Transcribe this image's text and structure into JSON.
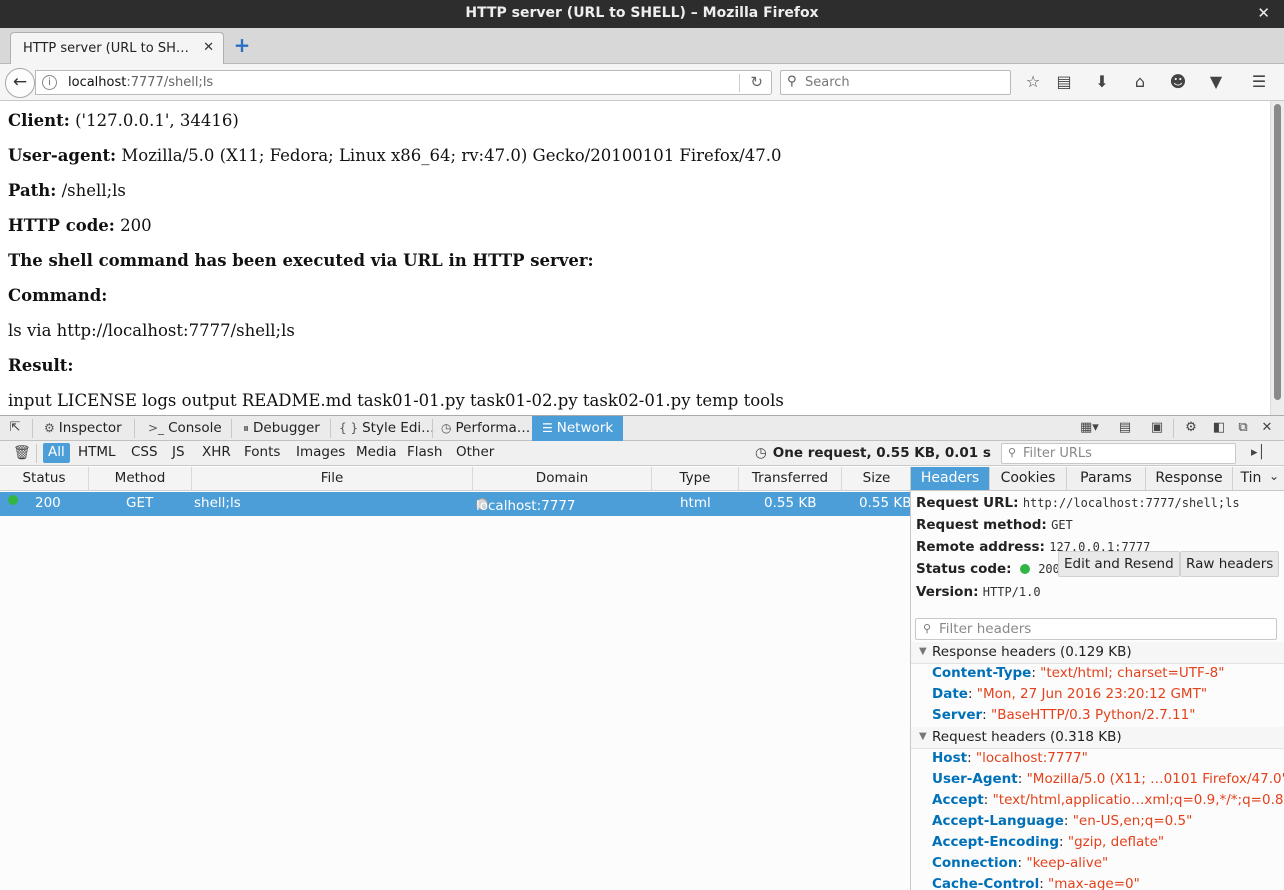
{
  "window": {
    "title": "HTTP server (URL to SHELL) – Mozilla Firefox",
    "close_glyph": "✕"
  },
  "tab": {
    "title": "HTTP server (URL to SH…",
    "close_glyph": "✕",
    "new_glyph": "+"
  },
  "nav": {
    "url_host": "localhost",
    "url_rest": ":7777/shell;ls",
    "search_placeholder": "Search"
  },
  "page": {
    "client_label": "Client:",
    "client_value": " ('127.0.0.1', 34416)",
    "ua_label": "User-agent:",
    "ua_value": " Mozilla/5.0 (X11; Fedora; Linux x86_64; rv:47.0) Gecko/20100101 Firefox/47.0",
    "path_label": "Path:",
    "path_value": " /shell;ls",
    "code_label": "HTTP code:",
    "code_value": " 200",
    "executed": "The shell command has been executed via URL in HTTP server:",
    "command_label": "Command:",
    "command_value": "ls via http://localhost:7777/shell;ls",
    "result_label": "Result:",
    "result_value": "input LICENSE logs output README.md task01-01.py task01-02.py task02-01.py temp tools"
  },
  "devtools": {
    "tabs": {
      "inspector": "Inspector",
      "console": "Console",
      "debugger": "Debugger",
      "style_editor": "Style Edi…",
      "performance": "Performa…",
      "network": "Network"
    },
    "filters": [
      "All",
      "HTML",
      "CSS",
      "JS",
      "XHR",
      "Fonts",
      "Images",
      "Media",
      "Flash",
      "Other"
    ],
    "summary": "One request, 0.55 KB, 0.01 s",
    "filter_urls_placeholder": "Filter URLs",
    "columns": {
      "status": "Status",
      "method": "Method",
      "file": "File",
      "domain": "Domain",
      "type": "Type",
      "transferred": "Transferred",
      "size": "Size"
    },
    "request": {
      "status": "200",
      "method": "GET",
      "file": "shell;ls",
      "domain": "localhost:7777",
      "type": "html",
      "transferred": "0.55 KB",
      "size": "0.55 KB"
    },
    "panel_tabs": {
      "headers": "Headers",
      "cookies": "Cookies",
      "params": "Params",
      "response": "Response",
      "timings": "Tin"
    },
    "details": {
      "url_label": "Request URL:",
      "url_value": "http://localhost:7777/shell;ls",
      "method_label": "Request method:",
      "method_value": "GET",
      "remote_label": "Remote address:",
      "remote_value": "127.0.0.1:7777",
      "status_label": "Status code:",
      "status_value": "200…",
      "edit_resend": "Edit and Resend",
      "raw_headers": "Raw headers",
      "version_label": "Version:",
      "version_value": "HTTP/1.0",
      "filter_headers_placeholder": "Filter headers",
      "response_headers_title": "Response headers (0.129 KB)",
      "request_headers_title": "Request headers (0.318 KB)"
    },
    "response_headers": [
      {
        "k": "Content-Type",
        "v": "\"text/html; charset=UTF-8\""
      },
      {
        "k": "Date",
        "v": "\"Mon, 27 Jun 2016 23:20:12 GMT\""
      },
      {
        "k": "Server",
        "v": "\"BaseHTTP/0.3 Python/2.7.11\""
      }
    ],
    "request_headers": [
      {
        "k": "Host",
        "v": "\"localhost:7777\""
      },
      {
        "k": "User-Agent",
        "v": "\"Mozilla/5.0 (X11; …0101 Firefox/47.0\""
      },
      {
        "k": "Accept",
        "v": "\"text/html,applicatio…xml;q=0.9,*/*;q=0.8\""
      },
      {
        "k": "Accept-Language",
        "v": "\"en-US,en;q=0.5\""
      },
      {
        "k": "Accept-Encoding",
        "v": "\"gzip, deflate\""
      },
      {
        "k": "Connection",
        "v": "\"keep-alive\""
      },
      {
        "k": "Cache-Control",
        "v": "\"max-age=0\""
      }
    ]
  },
  "colors": {
    "accent": "#4c9ed9",
    "status_ok": "#32b643",
    "header_key": "#0070b8",
    "header_value": "#e4411b"
  }
}
